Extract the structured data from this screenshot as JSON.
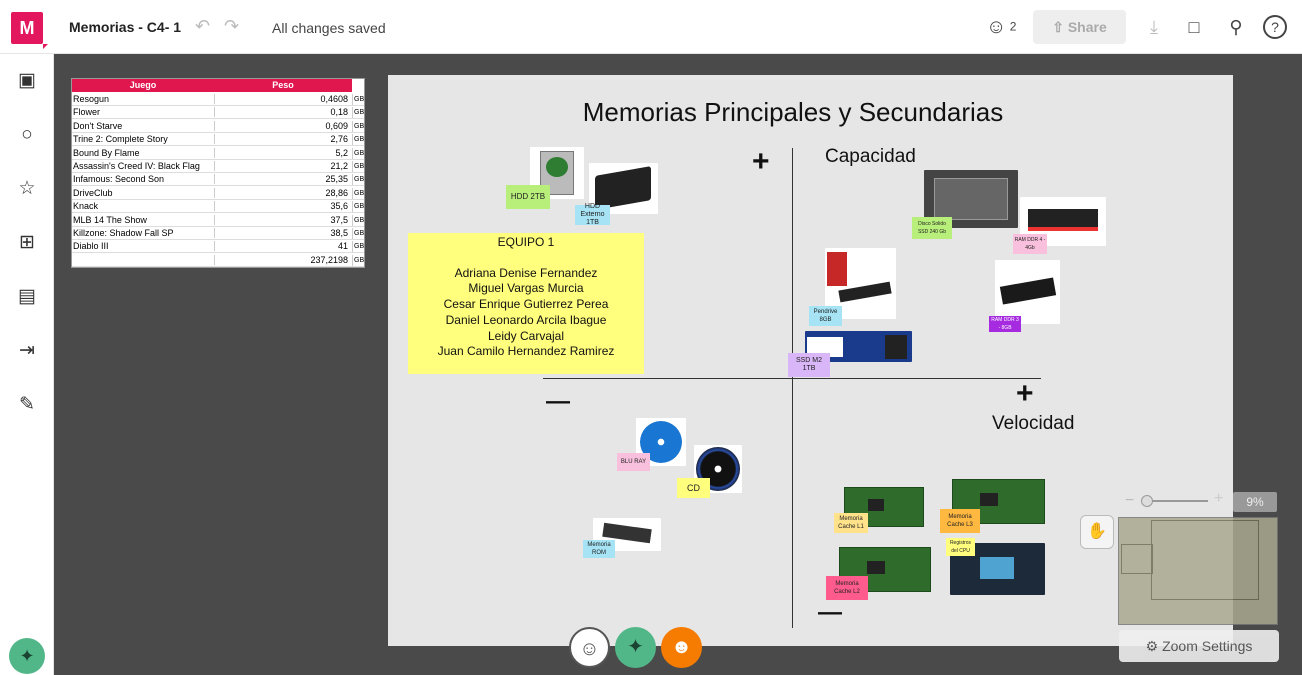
{
  "app": {
    "logo_letter": "M",
    "board_title": "Memorias - C4- 1",
    "save_status": "All changes saved",
    "user_count": "2",
    "share_label": "Share",
    "accent_color": "#e3175e"
  },
  "sheet": {
    "headers": [
      "Juego",
      "Peso"
    ],
    "header_color": "#e0164f",
    "rows": [
      {
        "juego": "Resogun",
        "peso": "0,4608",
        "unit": "GB"
      },
      {
        "juego": "Flower",
        "peso": "0,18",
        "unit": "GB"
      },
      {
        "juego": "Don't Starve",
        "peso": "0,609",
        "unit": "GB"
      },
      {
        "juego": "Trine 2: Complete Story",
        "peso": "2,76",
        "unit": "GB"
      },
      {
        "juego": "Bound By Flame",
        "peso": "5,2",
        "unit": "GB"
      },
      {
        "juego": "Assassin's Creed IV: Black Flag",
        "peso": "21,2",
        "unit": "GB"
      },
      {
        "juego": "Infamous: Second Son",
        "peso": "25,35",
        "unit": "GB"
      },
      {
        "juego": "DriveClub",
        "peso": "28,86",
        "unit": "GB"
      },
      {
        "juego": "Knack",
        "peso": "35,6",
        "unit": "GB"
      },
      {
        "juego": "MLB 14 The Show",
        "peso": "37,5",
        "unit": "GB"
      },
      {
        "juego": "Killzone: Shadow Fall SP",
        "peso": "38,5",
        "unit": "GB"
      },
      {
        "juego": "Diablo III",
        "peso": "41",
        "unit": "GB"
      },
      {
        "juego": "",
        "peso": "237,2198",
        "unit": "GB"
      }
    ]
  },
  "board": {
    "title": "Memorias Principales y Secundarias",
    "plus": "+",
    "minus": "—",
    "y_label": "Capacidad",
    "x_label": "Velocidad",
    "team": {
      "heading": "EQUIPO 1",
      "members": [
        "Adriana Denise Fernandez",
        "Miguel Vargas Murcia",
        "Cesar Enrique Gutierrez Perea",
        "Daniel Leonardo Arcila Ibague",
        "Leidy Carvajal",
        "Juan Camilo Hernandez Ramirez"
      ]
    },
    "notes": {
      "hdd2tb": "HDD 2TB",
      "hdd_ext": "HDD Externo 1TB",
      "ssd": "Disco Solido SSD 240 Gb",
      "ram4": "RAM DDR 4 - 4Gb",
      "pendrive": "Pendrive 8GB",
      "ram3": "RAM DDR 3 - 8GB",
      "ssdm2": "SSD M2 1TB",
      "bluray": "BLU RAY",
      "cd": "CD",
      "rom": "Memoria ROM",
      "cache1": "Memoria Cache L1",
      "cache3": "Memoria Cache L3",
      "registros": "Registros del CPU",
      "cache2": "Memoria Cache L2"
    }
  },
  "zoom": {
    "minus": "−",
    "plus": "+",
    "percent": "9%",
    "settings_label": "Zoom Settings"
  }
}
